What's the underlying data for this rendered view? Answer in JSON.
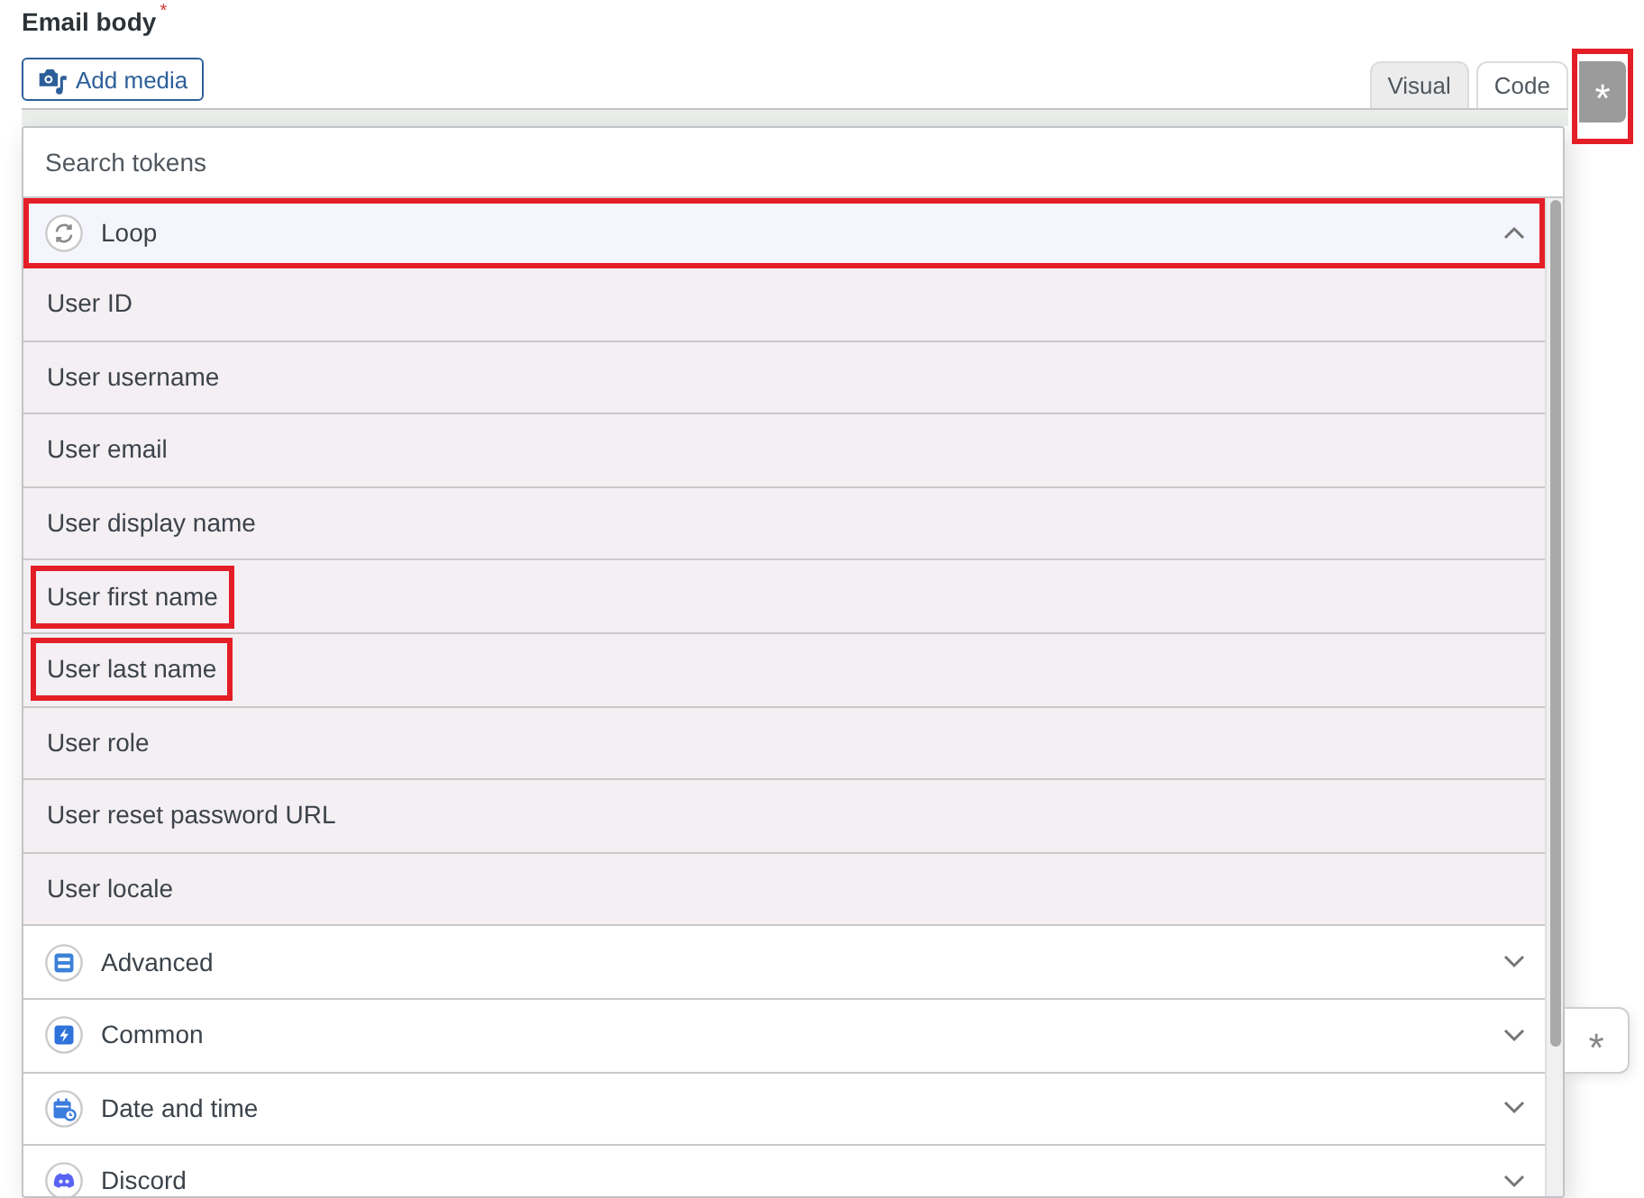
{
  "field": {
    "label": "Email body",
    "required_mark": "*"
  },
  "add_media": {
    "label": "Add media"
  },
  "editor_tabs": [
    {
      "label": "Visual",
      "selected": true
    },
    {
      "label": "Code",
      "selected": false
    }
  ],
  "token_dropdown": {
    "search": {
      "placeholder": "Search tokens"
    },
    "groups": [
      {
        "kind": "loop",
        "label": "Loop",
        "expanded": true,
        "highlighted": true,
        "tokens": [
          {
            "label": "User ID",
            "highlighted": false
          },
          {
            "label": "User username",
            "highlighted": false
          },
          {
            "label": "User email",
            "highlighted": false
          },
          {
            "label": "User display name",
            "highlighted": false
          },
          {
            "label": "User first name",
            "highlighted": true
          },
          {
            "label": "User last name",
            "highlighted": true
          },
          {
            "label": "User role",
            "highlighted": false
          },
          {
            "label": "User reset password URL",
            "highlighted": false
          },
          {
            "label": "User locale",
            "highlighted": false
          }
        ]
      },
      {
        "kind": "advanced",
        "label": "Advanced",
        "expanded": false,
        "highlighted": false
      },
      {
        "kind": "common",
        "label": "Common",
        "expanded": false,
        "highlighted": false
      },
      {
        "kind": "datetime",
        "label": "Date and time",
        "expanded": false,
        "highlighted": false
      },
      {
        "kind": "discord",
        "label": "Discord",
        "expanded": false,
        "highlighted": false
      }
    ]
  },
  "token_buttons": [
    {
      "label": "*",
      "active": true,
      "highlighted": true
    },
    {
      "label": "*",
      "active": false,
      "highlighted": false
    }
  ]
}
